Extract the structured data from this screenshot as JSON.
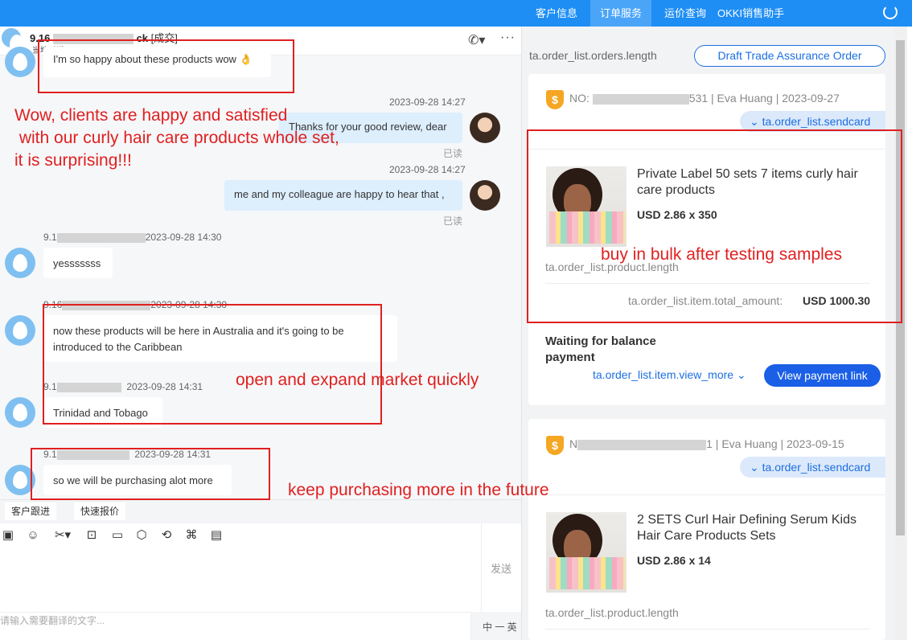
{
  "topnav": {
    "tabs": [
      "客户信息",
      "订单服务",
      "运价查询",
      "OKKI销售助手"
    ]
  },
  "chat_header": {
    "contact_prefix": "9.16",
    "contact_suffix": "ck",
    "status": "[成交]",
    "local_time": "当地时间 16:28"
  },
  "messages": [
    {
      "text": "I'm so happy about these products wow 👌"
    },
    {
      "time": "2023-09-28 14:27",
      "text": "Thanks for your good review, dear",
      "read": "已读"
    },
    {
      "time": "2023-09-28 14:27",
      "text": "me and my colleague are happy to hear that ,",
      "read": "已读"
    },
    {
      "sender_prefix": "9.1",
      "time": "2023-09-28 14:30",
      "text": "yesssssss"
    },
    {
      "sender_prefix": "9.16",
      "time": "2023-09-28 14:30",
      "text": "now these products will be here in Australia and it's going to be introduced to the Caribbean"
    },
    {
      "sender_prefix": "9.1",
      "time": "2023-09-28 14:31",
      "text": "Trinidad and Tobago"
    },
    {
      "sender_prefix": "9.1",
      "time": "2023-09-28 14:31",
      "text": "so we will be purchasing alot more"
    }
  ],
  "quick_tabs": [
    "客户跟进",
    "快速报价"
  ],
  "composer": {
    "send_label": "发送",
    "translate_placeholder": "请输入需要翻译的文字...",
    "lang_toggle": "中 一 英"
  },
  "order_panel": {
    "orders_count_label": "ta.order_list.orders.length",
    "draft_button": "Draft Trade Assurance Order",
    "orders": [
      {
        "no_label": "NO:",
        "no_suffix": "531",
        "meta": " | Eva Huang | 2023-09-27",
        "sendcard": "ta.order_list.sendcard",
        "product_name": "Private Label 50 sets 7 items curly hair care products",
        "price": "USD 2.86 x 350",
        "product_length": "ta.order_list.product.length",
        "total_label": "ta.order_list.item.total_amount:",
        "total_value": "USD 1000.30",
        "status": "Waiting for balance payment",
        "view_more": "ta.order_list.item.view_more",
        "pay_button": "View payment link"
      },
      {
        "no_label": "N",
        "no_suffix": "1",
        "meta": " | Eva Huang | 2023-09-15",
        "sendcard": "ta.order_list.sendcard",
        "product_name": "2 SETS Curl Hair Defining Serum Kids Hair Care Products Sets",
        "price": "USD 2.86 x 14",
        "product_length": "ta.order_list.product.length"
      }
    ]
  },
  "annotations": [
    "Wow, clients are happy and satisfied\n with our curly hair care products whole set,\nit is surprising!!!",
    "buy in bulk after testing samples",
    "open and expand market quickly",
    "keep purchasing more in the future"
  ],
  "colors": {
    "topbar": "#1e8ef5",
    "primary": "#1c6fe0",
    "annotation_red": "#e02020"
  }
}
